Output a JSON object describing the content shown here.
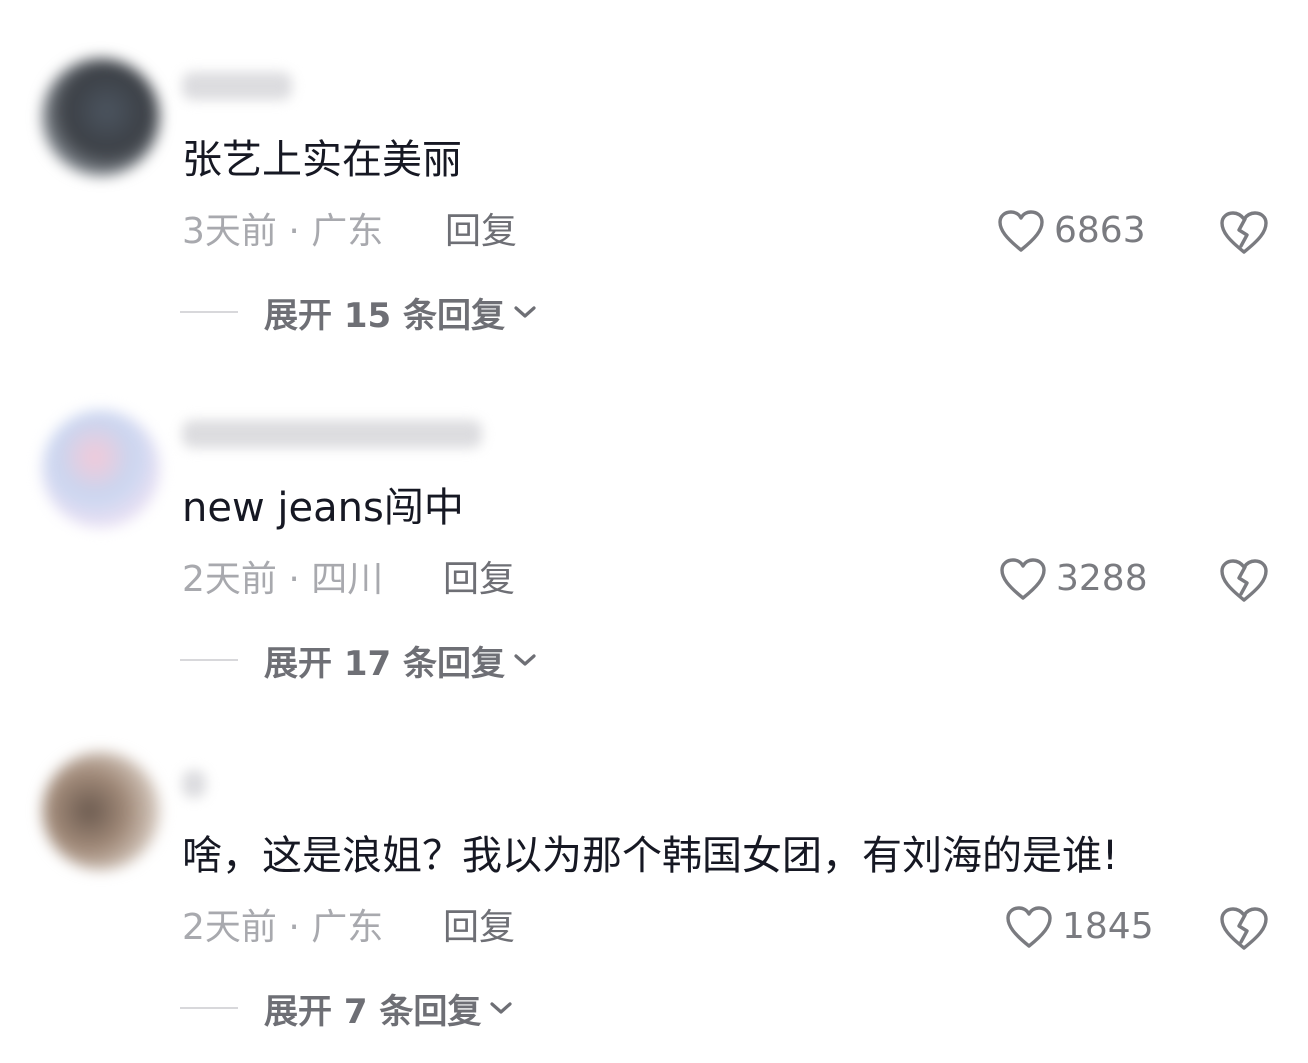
{
  "comments": [
    {
      "text": "张艺上实在美丽",
      "meta": "3天前 · 广东",
      "reply_label": "回复",
      "likes": "6863",
      "expand_label": "展开 15 条回复"
    },
    {
      "text": "new jeans闯中",
      "meta": "2天前 · 四川",
      "reply_label": "回复",
      "likes": "3288",
      "expand_label": "展开 17 条回复"
    },
    {
      "text": "啥，这是浪姐？我以为那个韩国女团，有刘海的是谁!",
      "meta": "2天前 · 广东",
      "reply_label": "回复",
      "likes": "1845",
      "expand_label": "展开 7 条回复"
    }
  ],
  "icons": {
    "like": "heart-outline-icon",
    "dislike": "broken-heart-icon",
    "expand": "chevron-down-icon"
  },
  "colors": {
    "text": "#161823",
    "meta": "#a8a9ae",
    "secondary": "#6e6f75"
  }
}
